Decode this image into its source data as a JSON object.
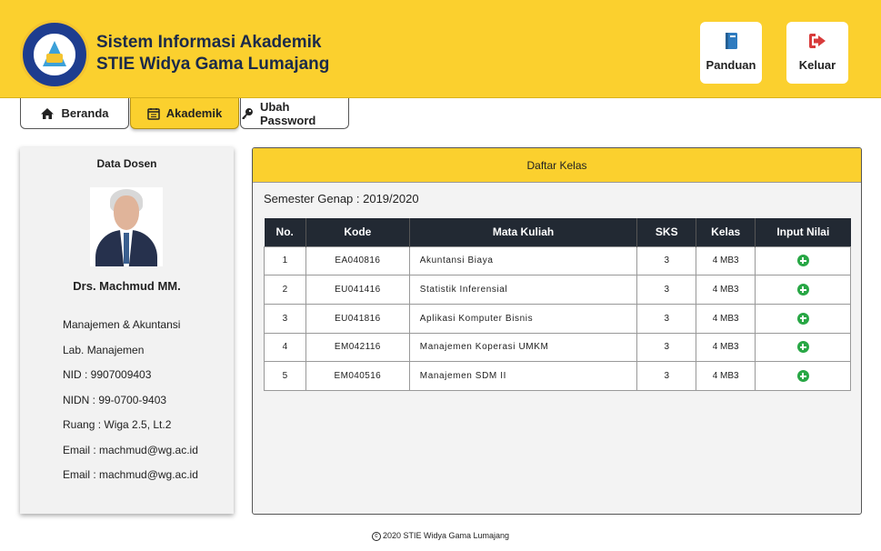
{
  "header": {
    "brand_line1": "Sistem Informasi Akademik",
    "brand_line2": "STIE Widya Gama Lumajang",
    "panduan_label": "Panduan",
    "keluar_label": "Keluar",
    "accent_color": "#fbd02e"
  },
  "nav": {
    "tabs": [
      {
        "label": "Beranda",
        "icon": "home-icon"
      },
      {
        "label": "Akademik",
        "icon": "calendar-icon",
        "active": true
      },
      {
        "label": "Ubah Password",
        "icon": "key-icon"
      }
    ]
  },
  "dosen": {
    "title": "Data Dosen",
    "name": "Drs. Machmud MM.",
    "info": [
      "Manajemen & Akuntansi",
      "Lab. Manajemen",
      "NID : 9907009403",
      "NIDN : 99-0700-9403",
      "Ruang : Wiga 2.5, Lt.2",
      "Email : machmud@wg.ac.id",
      "Email : machmud@wg.ac.id"
    ]
  },
  "kelas": {
    "title": "Daftar Kelas",
    "semester": "Semester Genap : 2019/2020",
    "columns": [
      "No.",
      "Kode",
      "Mata Kuliah",
      "SKS",
      "Kelas",
      "Input Nilai"
    ],
    "rows": [
      {
        "no": "1",
        "kode": "EA040816",
        "mk": "Akuntansi Biaya",
        "sks": "3",
        "kelas": "4 MB3"
      },
      {
        "no": "2",
        "kode": "EU041416",
        "mk": "Statistik Inferensial",
        "sks": "3",
        "kelas": "4 MB3"
      },
      {
        "no": "3",
        "kode": "EU041816",
        "mk": "Aplikasi Komputer Bisnis",
        "sks": "3",
        "kelas": "4 MB3"
      },
      {
        "no": "4",
        "kode": "EM042116",
        "mk": "Manajemen Koperasi UMKM",
        "sks": "3",
        "kelas": "4 MB3"
      },
      {
        "no": "5",
        "kode": "EM040516",
        "mk": "Manajemen SDM II",
        "sks": "3",
        "kelas": "4 MB3"
      }
    ]
  },
  "footer": {
    "text": "2020 STIE Widya Gama Lumajang"
  }
}
